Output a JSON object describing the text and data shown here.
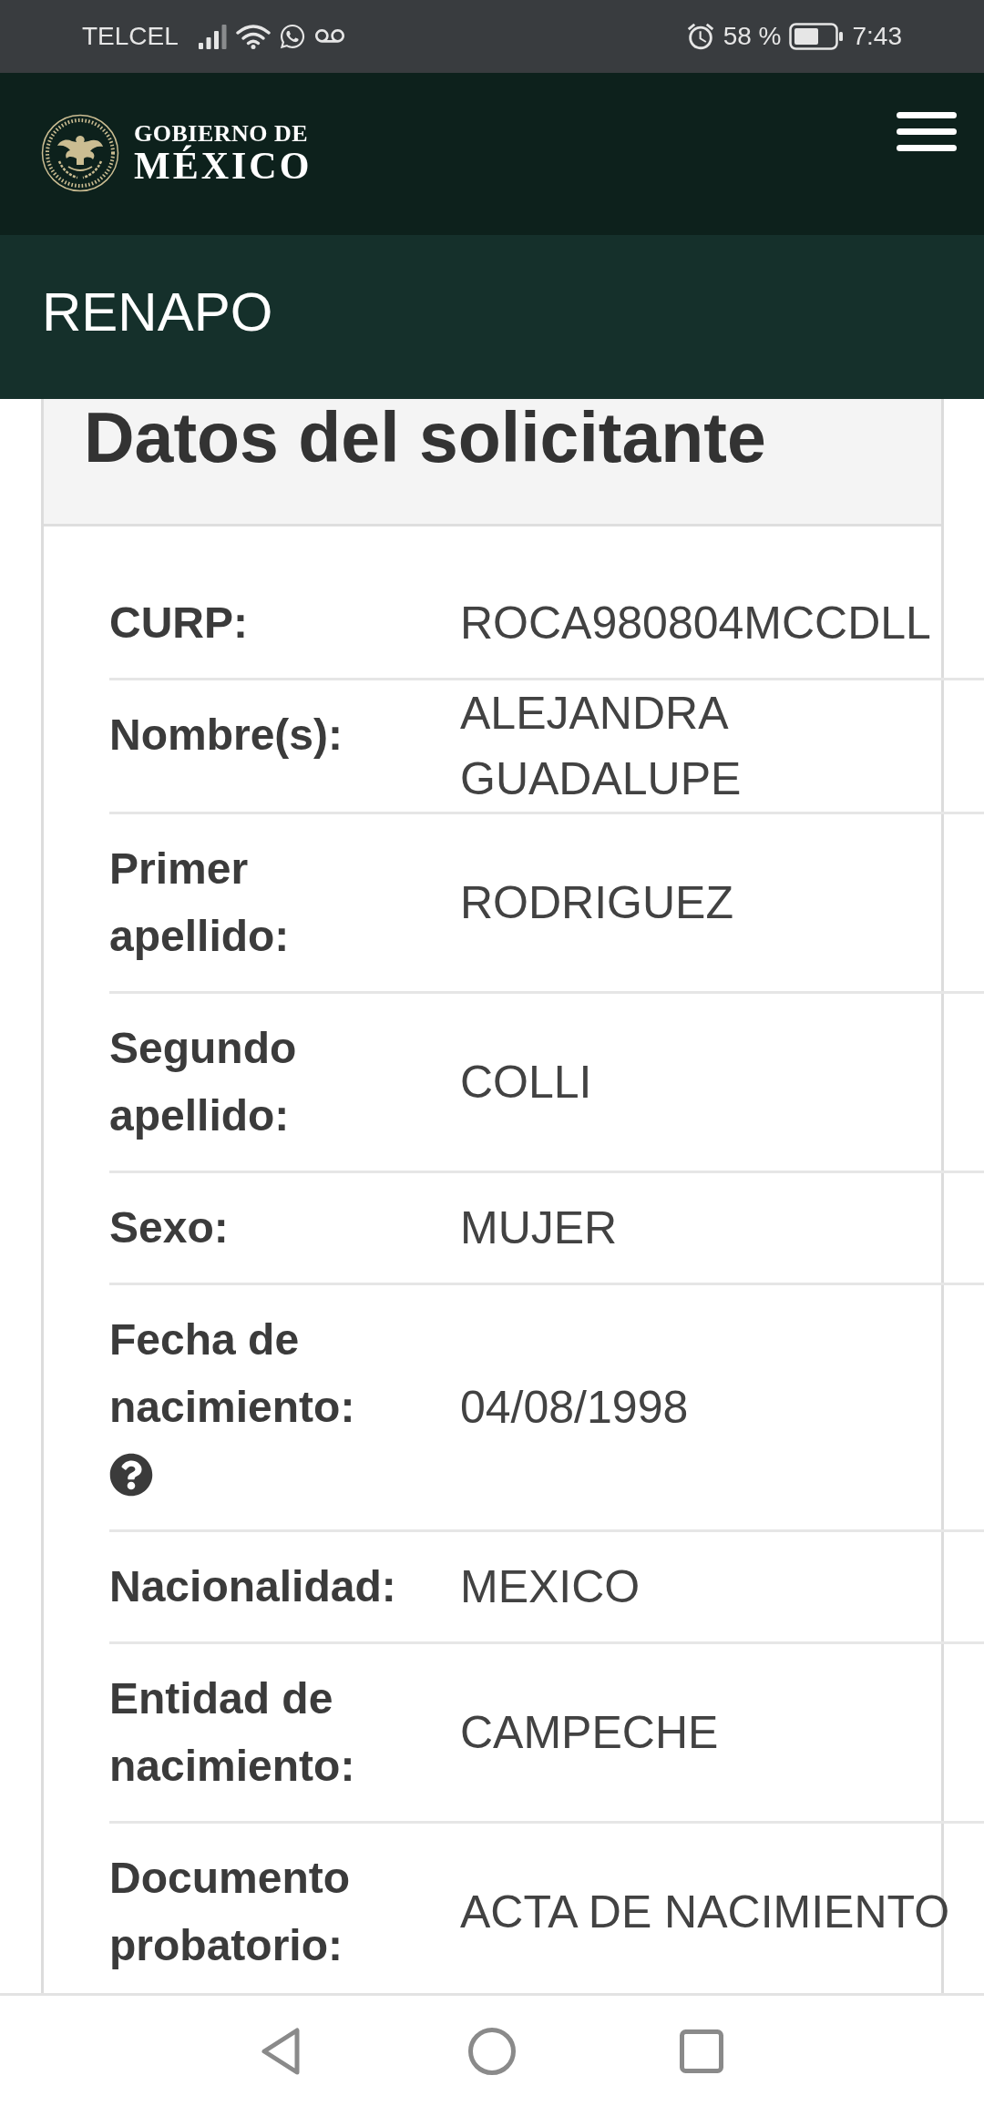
{
  "status_bar": {
    "carrier": "TELCEL",
    "battery": "58 %",
    "time": "7:43"
  },
  "header": {
    "logo_line_1": "GOBIERNO DE",
    "logo_line_2": "MÉXICO"
  },
  "banner": {
    "title": "RENAPO"
  },
  "card": {
    "title": "Datos del solicitante",
    "rows": [
      {
        "label": "CURP:",
        "value": "ROCA980804MCCDLL",
        "help": false
      },
      {
        "label": "Nombre(s):",
        "value": "ALEJANDRA GUADALUPE",
        "help": false
      },
      {
        "label": "Primer apellido:",
        "value": "RODRIGUEZ",
        "help": false
      },
      {
        "label": "Segundo apellido:",
        "value": "COLLI",
        "help": false
      },
      {
        "label": "Sexo:",
        "value": "MUJER",
        "help": false
      },
      {
        "label": "Fecha de nacimiento:",
        "value": "04/08/1998",
        "help": true
      },
      {
        "label": "Nacionalidad:",
        "value": "MEXICO",
        "help": false
      },
      {
        "label": "Entidad de nacimiento:",
        "value": "CAMPECHE",
        "help": false
      },
      {
        "label": "Documento probatorio:",
        "value": "ACTA DE NACIMIENTO",
        "help": false
      }
    ]
  }
}
